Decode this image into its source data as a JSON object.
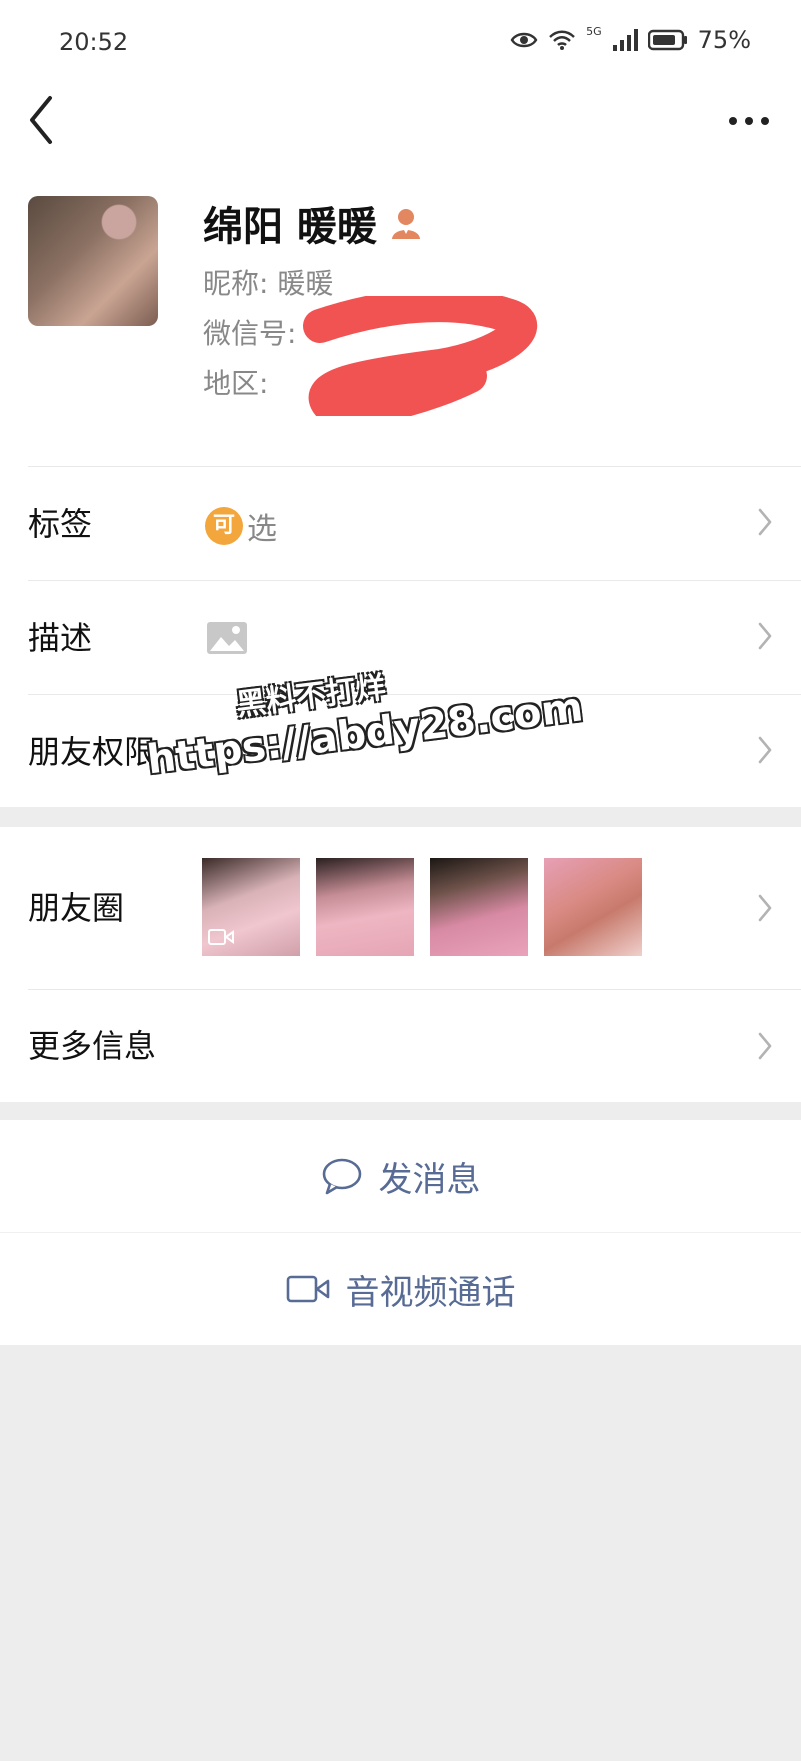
{
  "status_bar": {
    "time": "20:52",
    "battery": "75%",
    "network": "5G"
  },
  "profile": {
    "name": "绵阳 暖暖",
    "nickname_label": "昵称:",
    "nickname": "暖暖",
    "wechat_id_label": "微信号:",
    "region_label": "地区:"
  },
  "rows": {
    "tags": {
      "title": "标签",
      "badge": "可",
      "value": "选"
    },
    "description": {
      "title": "描述"
    },
    "permissions": {
      "title": "朋友权限"
    }
  },
  "moments": {
    "title": "朋友圈",
    "photo_count": 4
  },
  "more_info": {
    "title": "更多信息"
  },
  "actions": {
    "message": "发消息",
    "call": "音视频通话"
  },
  "watermark": {
    "line1": "黑料不打烊",
    "line2": "https://abdy28.com"
  },
  "colors": {
    "link": "#576b95",
    "tag_badge": "#f3a63b",
    "background": "#ededed"
  }
}
